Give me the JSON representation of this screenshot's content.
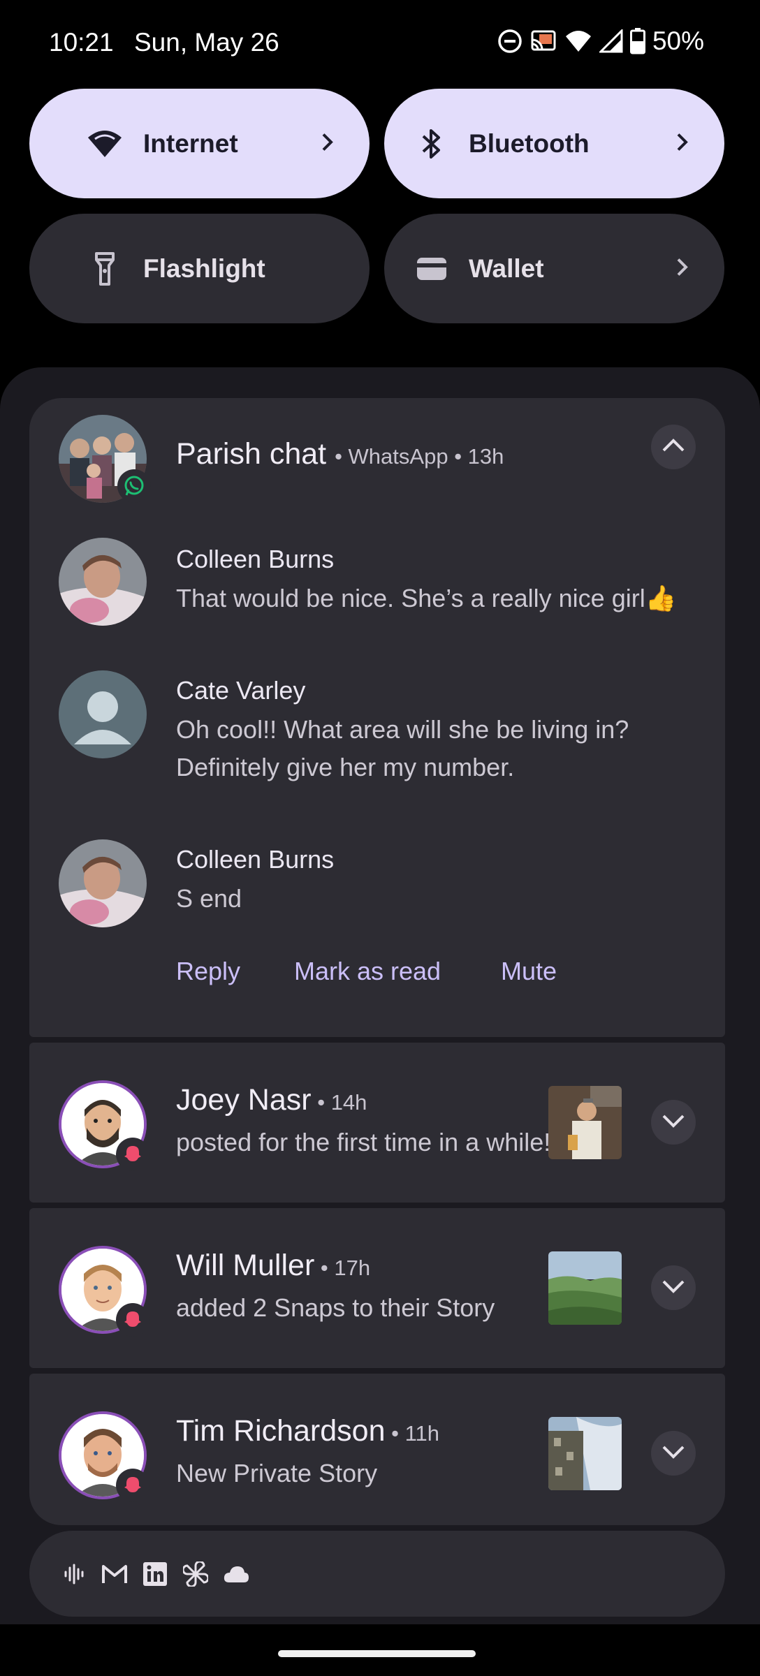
{
  "status_bar": {
    "time": "10:21",
    "date": "Sun, May 26",
    "battery": "50%",
    "icons": [
      "do-not-disturb-icon",
      "cast-icon",
      "wifi-icon",
      "cell-signal-icon",
      "battery-icon"
    ]
  },
  "quick_settings": {
    "internet": {
      "label": "Internet",
      "active": true,
      "icon": "wifi-icon"
    },
    "bluetooth": {
      "label": "Bluetooth",
      "active": true,
      "icon": "bluetooth-icon"
    },
    "flashlight": {
      "label": "Flashlight",
      "active": false,
      "icon": "flashlight-icon"
    },
    "wallet": {
      "label": "Wallet",
      "active": false,
      "icon": "wallet-icon"
    }
  },
  "chat": {
    "title": "Parish chat",
    "app": "WhatsApp",
    "time": "13h",
    "messages": [
      {
        "sender": "Colleen Burns",
        "text": "That would be nice. She’s a really nice girl👍"
      },
      {
        "sender": "Cate Varley",
        "text": "Oh cool!! What area will she be living in? Definitely give her my number."
      },
      {
        "sender": "Colleen Burns",
        "text": "S end"
      }
    ],
    "actions": [
      "Reply",
      "Mark as read",
      "Mute"
    ]
  },
  "notifications": [
    {
      "name": "Joey Nasr",
      "time": "14h",
      "text": "posted for the first time in a while!"
    },
    {
      "name": "Will Muller",
      "time": "17h",
      "text": "added 2 Snaps to their Story"
    },
    {
      "name": "Tim Richardson",
      "time": "11h",
      "text": "New Private Story"
    }
  ],
  "footer_icons": [
    "sound-wave-icon",
    "gmail-icon",
    "linkedin-icon",
    "pinwheel-icon",
    "cloud-icon"
  ],
  "colors": {
    "tile_active": "#e3ddfb",
    "tile_inactive": "#2d2c33",
    "action": "#cbbff8",
    "sheet": "#1b1a20"
  },
  "separator": "•"
}
